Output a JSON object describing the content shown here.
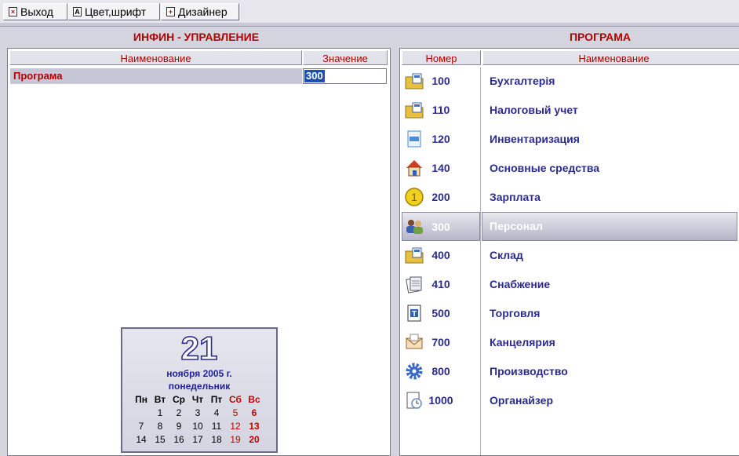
{
  "toolbar": {
    "exit_label": "Выход",
    "colors_label": "Цвет,шрифт",
    "designer_label": "Дизайнер"
  },
  "left": {
    "title": "ИНФИН - УПРАВЛЕНИЕ",
    "col_name": "Наименование",
    "col_value": "Значение",
    "row": {
      "label": "Програма",
      "value": "300"
    }
  },
  "calendar": {
    "day": "21",
    "month_year": "ноября 2005 г.",
    "weekday": "понедельник",
    "headers": [
      "Пн",
      "Вт",
      "Ср",
      "Чт",
      "Пт",
      "Сб",
      "Вс"
    ],
    "weeks": [
      [
        "",
        "1",
        "2",
        "3",
        "4",
        "5",
        "6"
      ],
      [
        "7",
        "8",
        "9",
        "10",
        "11",
        "12",
        "13"
      ],
      [
        "14",
        "15",
        "16",
        "17",
        "18",
        "19",
        "20"
      ]
    ]
  },
  "right": {
    "title": "ПРОГРАМА",
    "col_num": "Номер",
    "col_name": "Наименование",
    "selected": "300",
    "items": [
      {
        "num": "100",
        "name": "Бухгалтерія",
        "icon": "calculator-folder-icon",
        "color": "#e8c040"
      },
      {
        "num": "110",
        "name": "Налоговый учет",
        "icon": "tax-folder-icon",
        "color": "#e8c040"
      },
      {
        "num": "120",
        "name": "Инвентаризация",
        "icon": "document-icon",
        "color": "#4a8ad8"
      },
      {
        "num": "140",
        "name": "Основные средства",
        "icon": "house-icon",
        "color": "#d04020"
      },
      {
        "num": "200",
        "name": "Зарплата",
        "icon": "coin-icon",
        "color": "#f0d020"
      },
      {
        "num": "300",
        "name": "Персонал",
        "icon": "people-icon",
        "color": "#6a9a40"
      },
      {
        "num": "400",
        "name": "Склад",
        "icon": "warehouse-folder-icon",
        "color": "#e8c040"
      },
      {
        "num": "410",
        "name": "Снабжение",
        "icon": "papers-icon",
        "color": "#8a8aa8"
      },
      {
        "num": "500",
        "name": "Торговля",
        "icon": "text-document-icon",
        "color": "#2a60c0"
      },
      {
        "num": "700",
        "name": "Канцелярия",
        "icon": "envelope-icon",
        "color": "#e8a040"
      },
      {
        "num": "800",
        "name": "Производство",
        "icon": "gear-icon",
        "color": "#3a6ac8"
      },
      {
        "num": "1000",
        "name": "Органайзер",
        "icon": "organizer-clock-icon",
        "color": "#6a8ac8"
      }
    ]
  }
}
